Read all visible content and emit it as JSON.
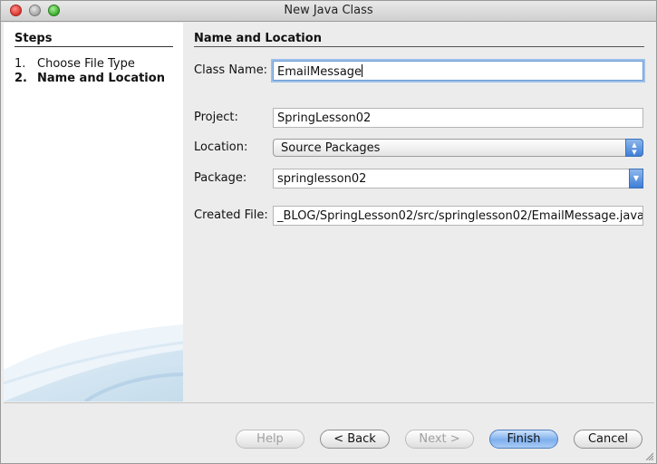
{
  "window": {
    "title": "New Java Class"
  },
  "steps": {
    "title": "Steps",
    "items": [
      {
        "num": "1.",
        "label": "Choose File Type"
      },
      {
        "num": "2.",
        "label": "Name and Location"
      }
    ]
  },
  "section": {
    "title": "Name and Location"
  },
  "form": {
    "class_name": {
      "label": "Class Name:",
      "value": "EmailMessage"
    },
    "project": {
      "label": "Project:",
      "value": "SpringLesson02"
    },
    "location": {
      "label": "Location:",
      "value": "Source Packages"
    },
    "package": {
      "label": "Package:",
      "value": "springlesson02"
    },
    "created_file": {
      "label": "Created File:",
      "value": "_BLOG/SpringLesson02/src/springlesson02/EmailMessage.java"
    }
  },
  "buttons": {
    "help": "Help",
    "back": "< Back",
    "next": "Next >",
    "finish": "Finish",
    "cancel": "Cancel"
  },
  "icons": {
    "close": "close-icon",
    "minimize": "minimize-icon",
    "maximize": "maximize-icon"
  },
  "colors": {
    "accent": "#3e7ed8",
    "focus_ring": "#9cc0ea"
  }
}
